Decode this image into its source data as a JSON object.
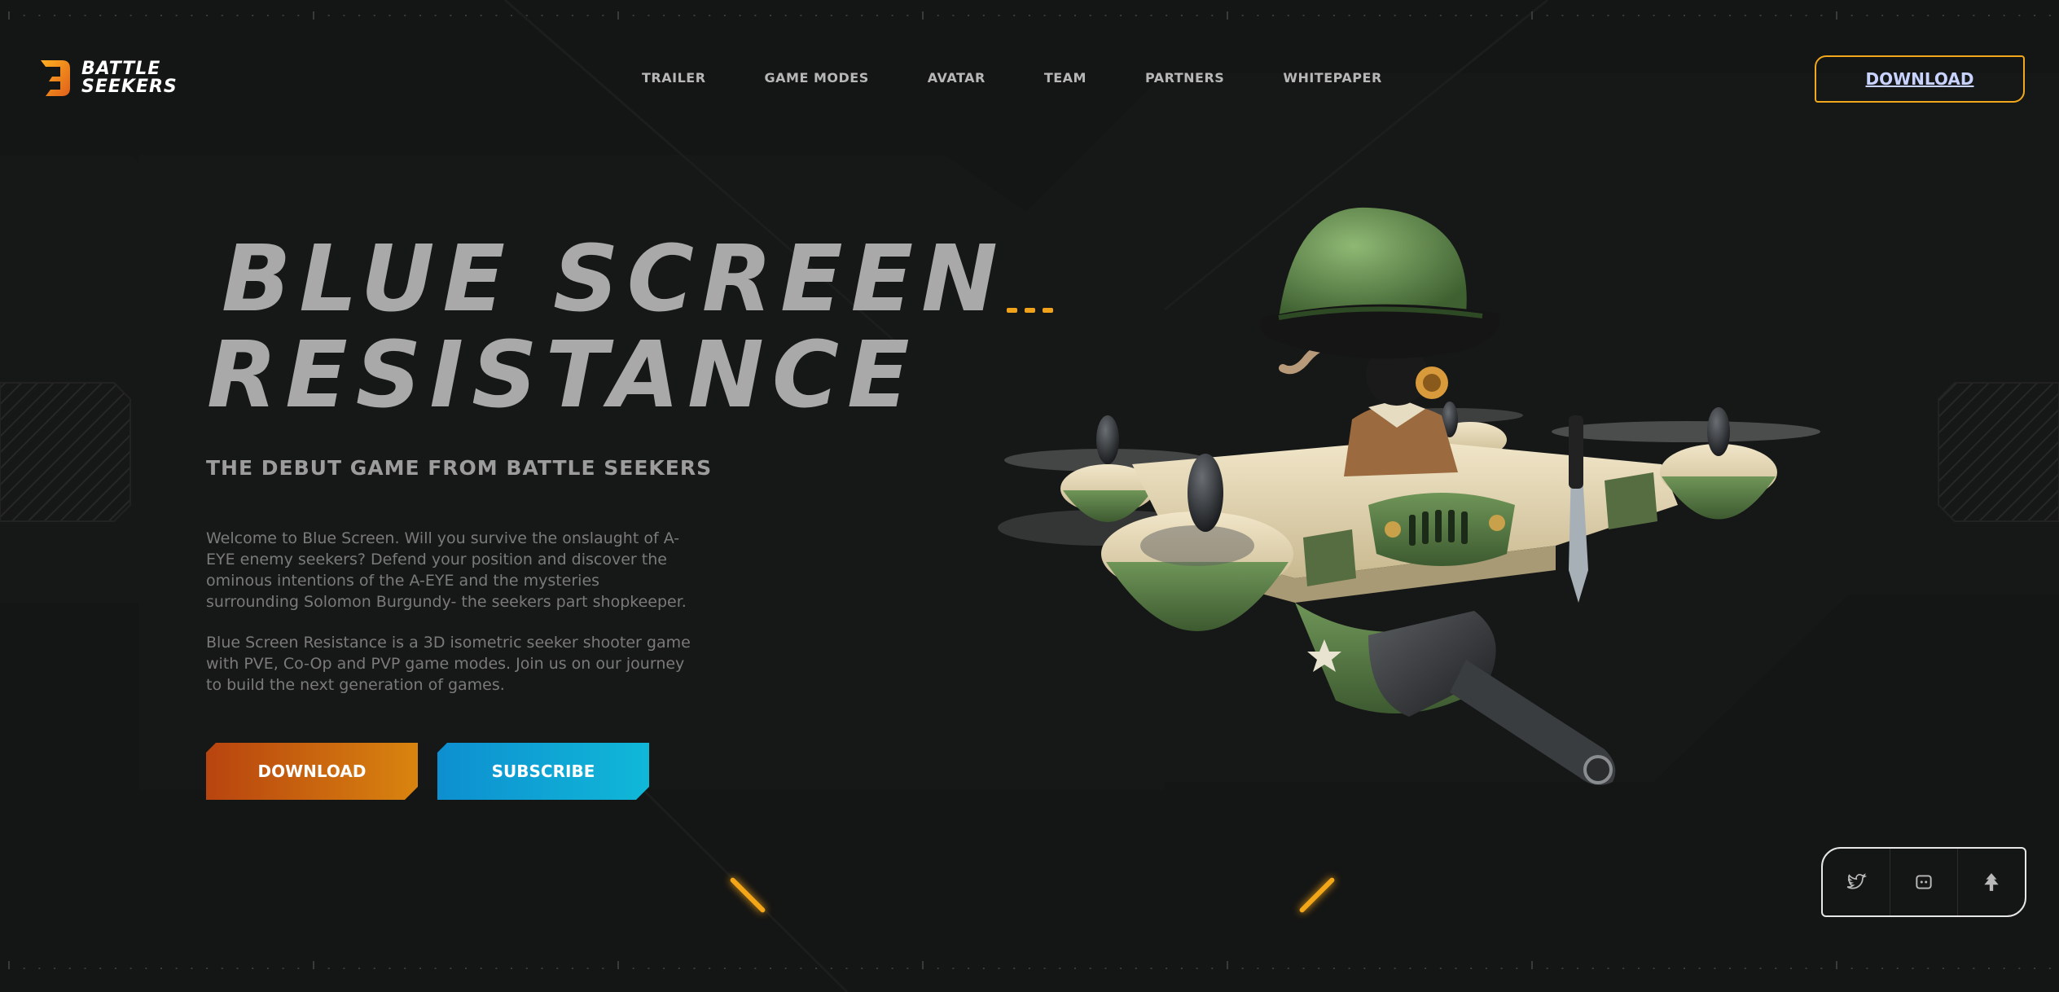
{
  "brand": {
    "line1": "BATTLE",
    "line2": "SEEKERS"
  },
  "nav": {
    "items": [
      {
        "label": "TRAILER"
      },
      {
        "label": "GAME MODES"
      },
      {
        "label": "AVATAR"
      },
      {
        "label": "TEAM"
      },
      {
        "label": "PARTNERS"
      },
      {
        "label": "WHITEPAPER"
      }
    ],
    "download_label": "DOWNLOAD"
  },
  "hero": {
    "title_line1": "BLUE SCREEN",
    "title_line2": "RESISTANCE",
    "subtitle": "THE DEBUT GAME FROM BATTLE SEEKERS",
    "paragraph1": "Welcome to Blue Screen. Will you survive the onslaught of A-EYE enemy seekers? Defend your position and discover the ominous intentions of the A-EYE and the mysteries surrounding Solomon Burgundy- the seekers part shopkeeper.",
    "paragraph2": "Blue Screen Resistance is a 3D isometric seeker shooter game with PVE, Co-Op and PVP game modes. Join us on our journey to build the next generation of games.",
    "download_label": "DOWNLOAD",
    "subscribe_label": "SUBSCRIBE"
  },
  "social": {
    "icons": [
      "twitter-icon",
      "discord-icon",
      "linktree-icon"
    ]
  },
  "colors": {
    "accent": "#f2a81c",
    "background": "#141515",
    "cta_download": "#c8620f",
    "cta_subscribe": "#10a8d6"
  }
}
